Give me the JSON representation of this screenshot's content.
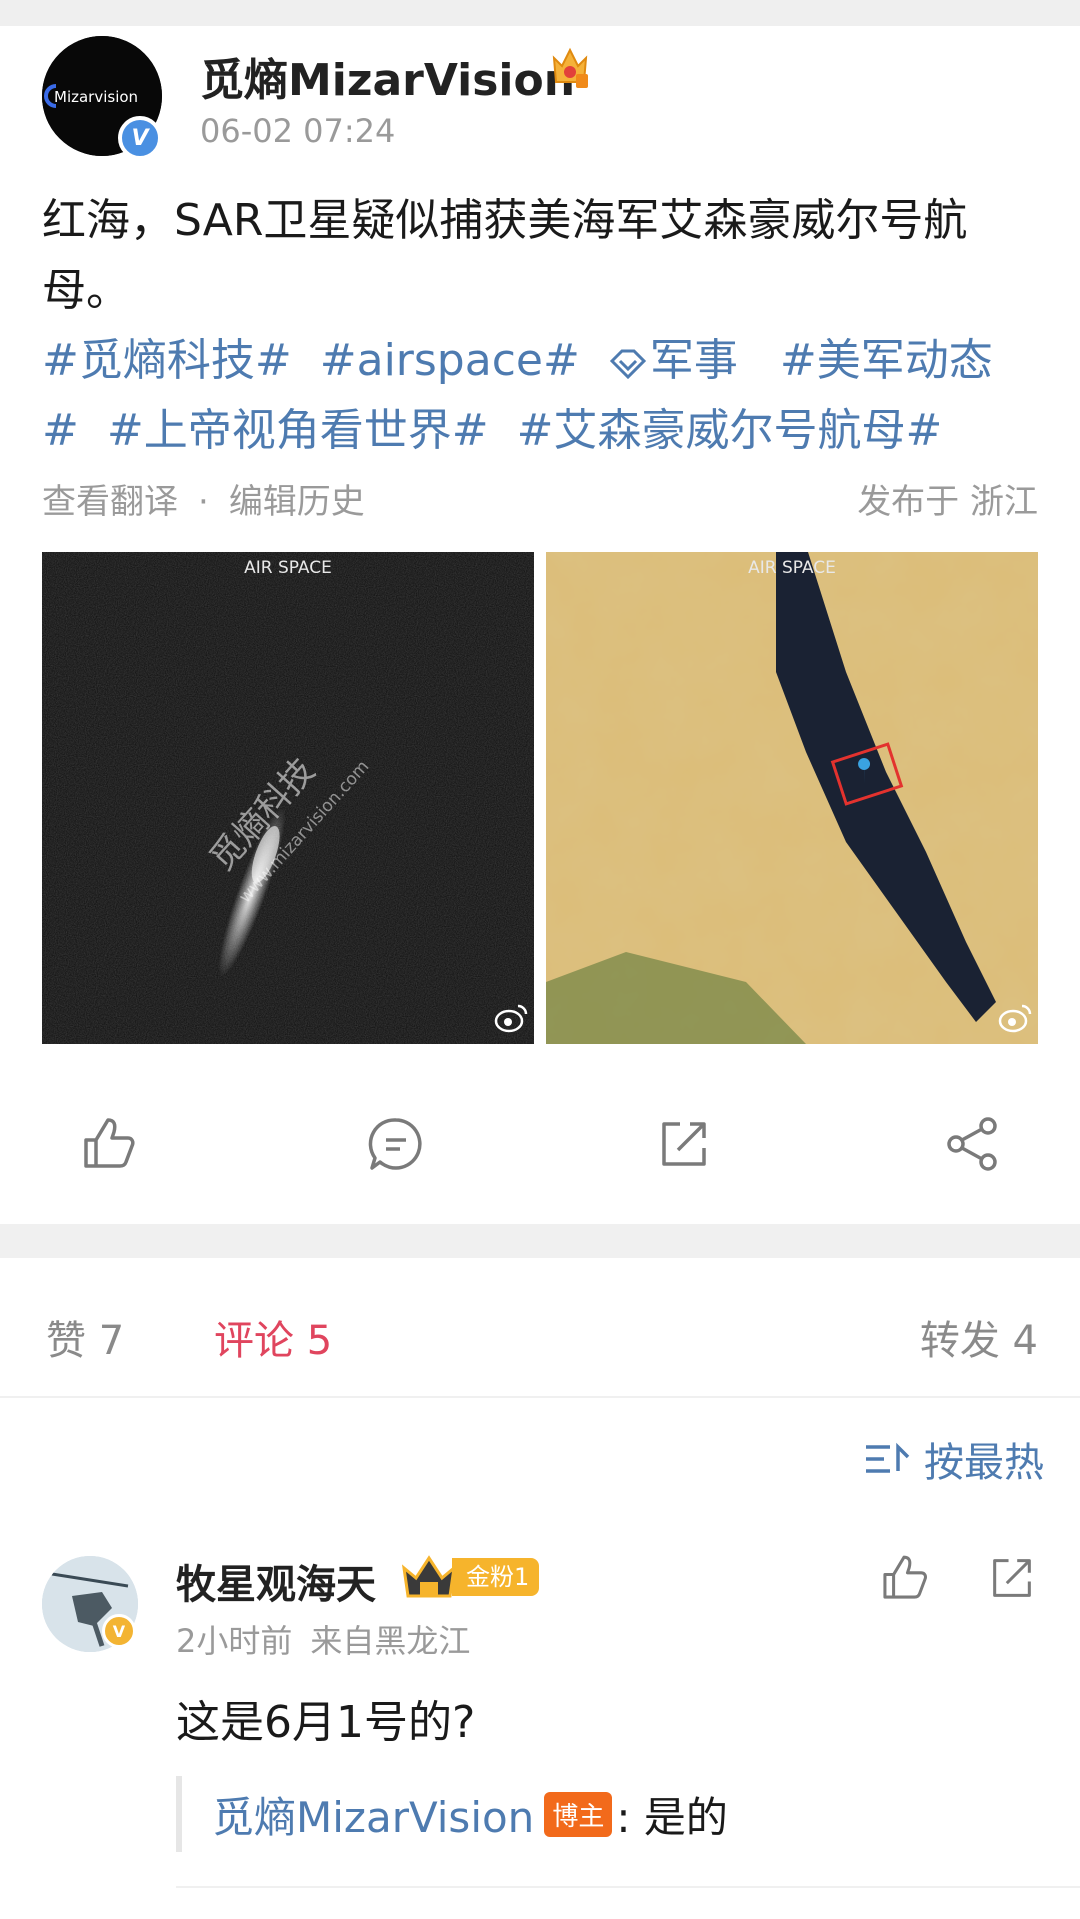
{
  "post": {
    "author": "觅熵MizarVision",
    "avatar_logo_text": "Mizarvision",
    "time": "06-02 07:24",
    "text": "红海，SAR卫星疑似捕获美海军艾森豪威尔号航母。",
    "tags": [
      "#觅熵科技#",
      "#airspace#",
      "军事",
      "#美军动态#",
      "#上帝视角看世界#",
      "#艾森豪威尔号航母#"
    ],
    "translate_link": "查看翻译",
    "dot": "·",
    "edit_history": "编辑历史",
    "location": "发布于 浙江",
    "image1": {
      "label": "AIR SPACE",
      "watermark": "觅熵科技",
      "url_watermark": "www.mizarvision.com"
    },
    "image2": {
      "label": "AIR SPACE"
    }
  },
  "stats": {
    "likes": "赞 7",
    "comments": "评论 5",
    "reposts": "转发 4"
  },
  "sort_label": "按最热",
  "comment": {
    "author": "牧星观海天",
    "fan_badge": "金粉1",
    "time": "2小时前",
    "location": "来自黑龙江",
    "text": "这是6月1号的?",
    "reply": {
      "author": "觅熵MizarVision",
      "tag": "博主",
      "text": ": 是的"
    }
  },
  "colors": {
    "link": "#4e7bb0",
    "active_tab": "#e0455e",
    "verified": "#4a90e2",
    "fan_gold": "#f6b42c",
    "owner_tag": "#f26a1b"
  }
}
